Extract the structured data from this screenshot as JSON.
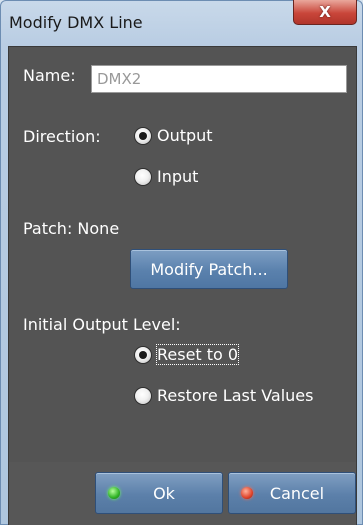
{
  "window": {
    "title": "Modify DMX Line",
    "close_glyph": "X"
  },
  "name": {
    "label": "Name:",
    "value": "DMX2"
  },
  "direction": {
    "label": "Direction:",
    "options": [
      {
        "label": "Output",
        "selected": true
      },
      {
        "label": "Input",
        "selected": false
      }
    ]
  },
  "patch": {
    "label": "Patch: None",
    "button": "Modify Patch..."
  },
  "initial_output": {
    "label": "Initial Output Level:",
    "options": [
      {
        "label": "Reset to 0",
        "selected": true
      },
      {
        "label": "Restore Last Values",
        "selected": false
      }
    ]
  },
  "footer": {
    "ok": "Ok",
    "cancel": "Cancel",
    "ok_led_color": "#2fb325",
    "cancel_led_color": "#e0442b"
  }
}
